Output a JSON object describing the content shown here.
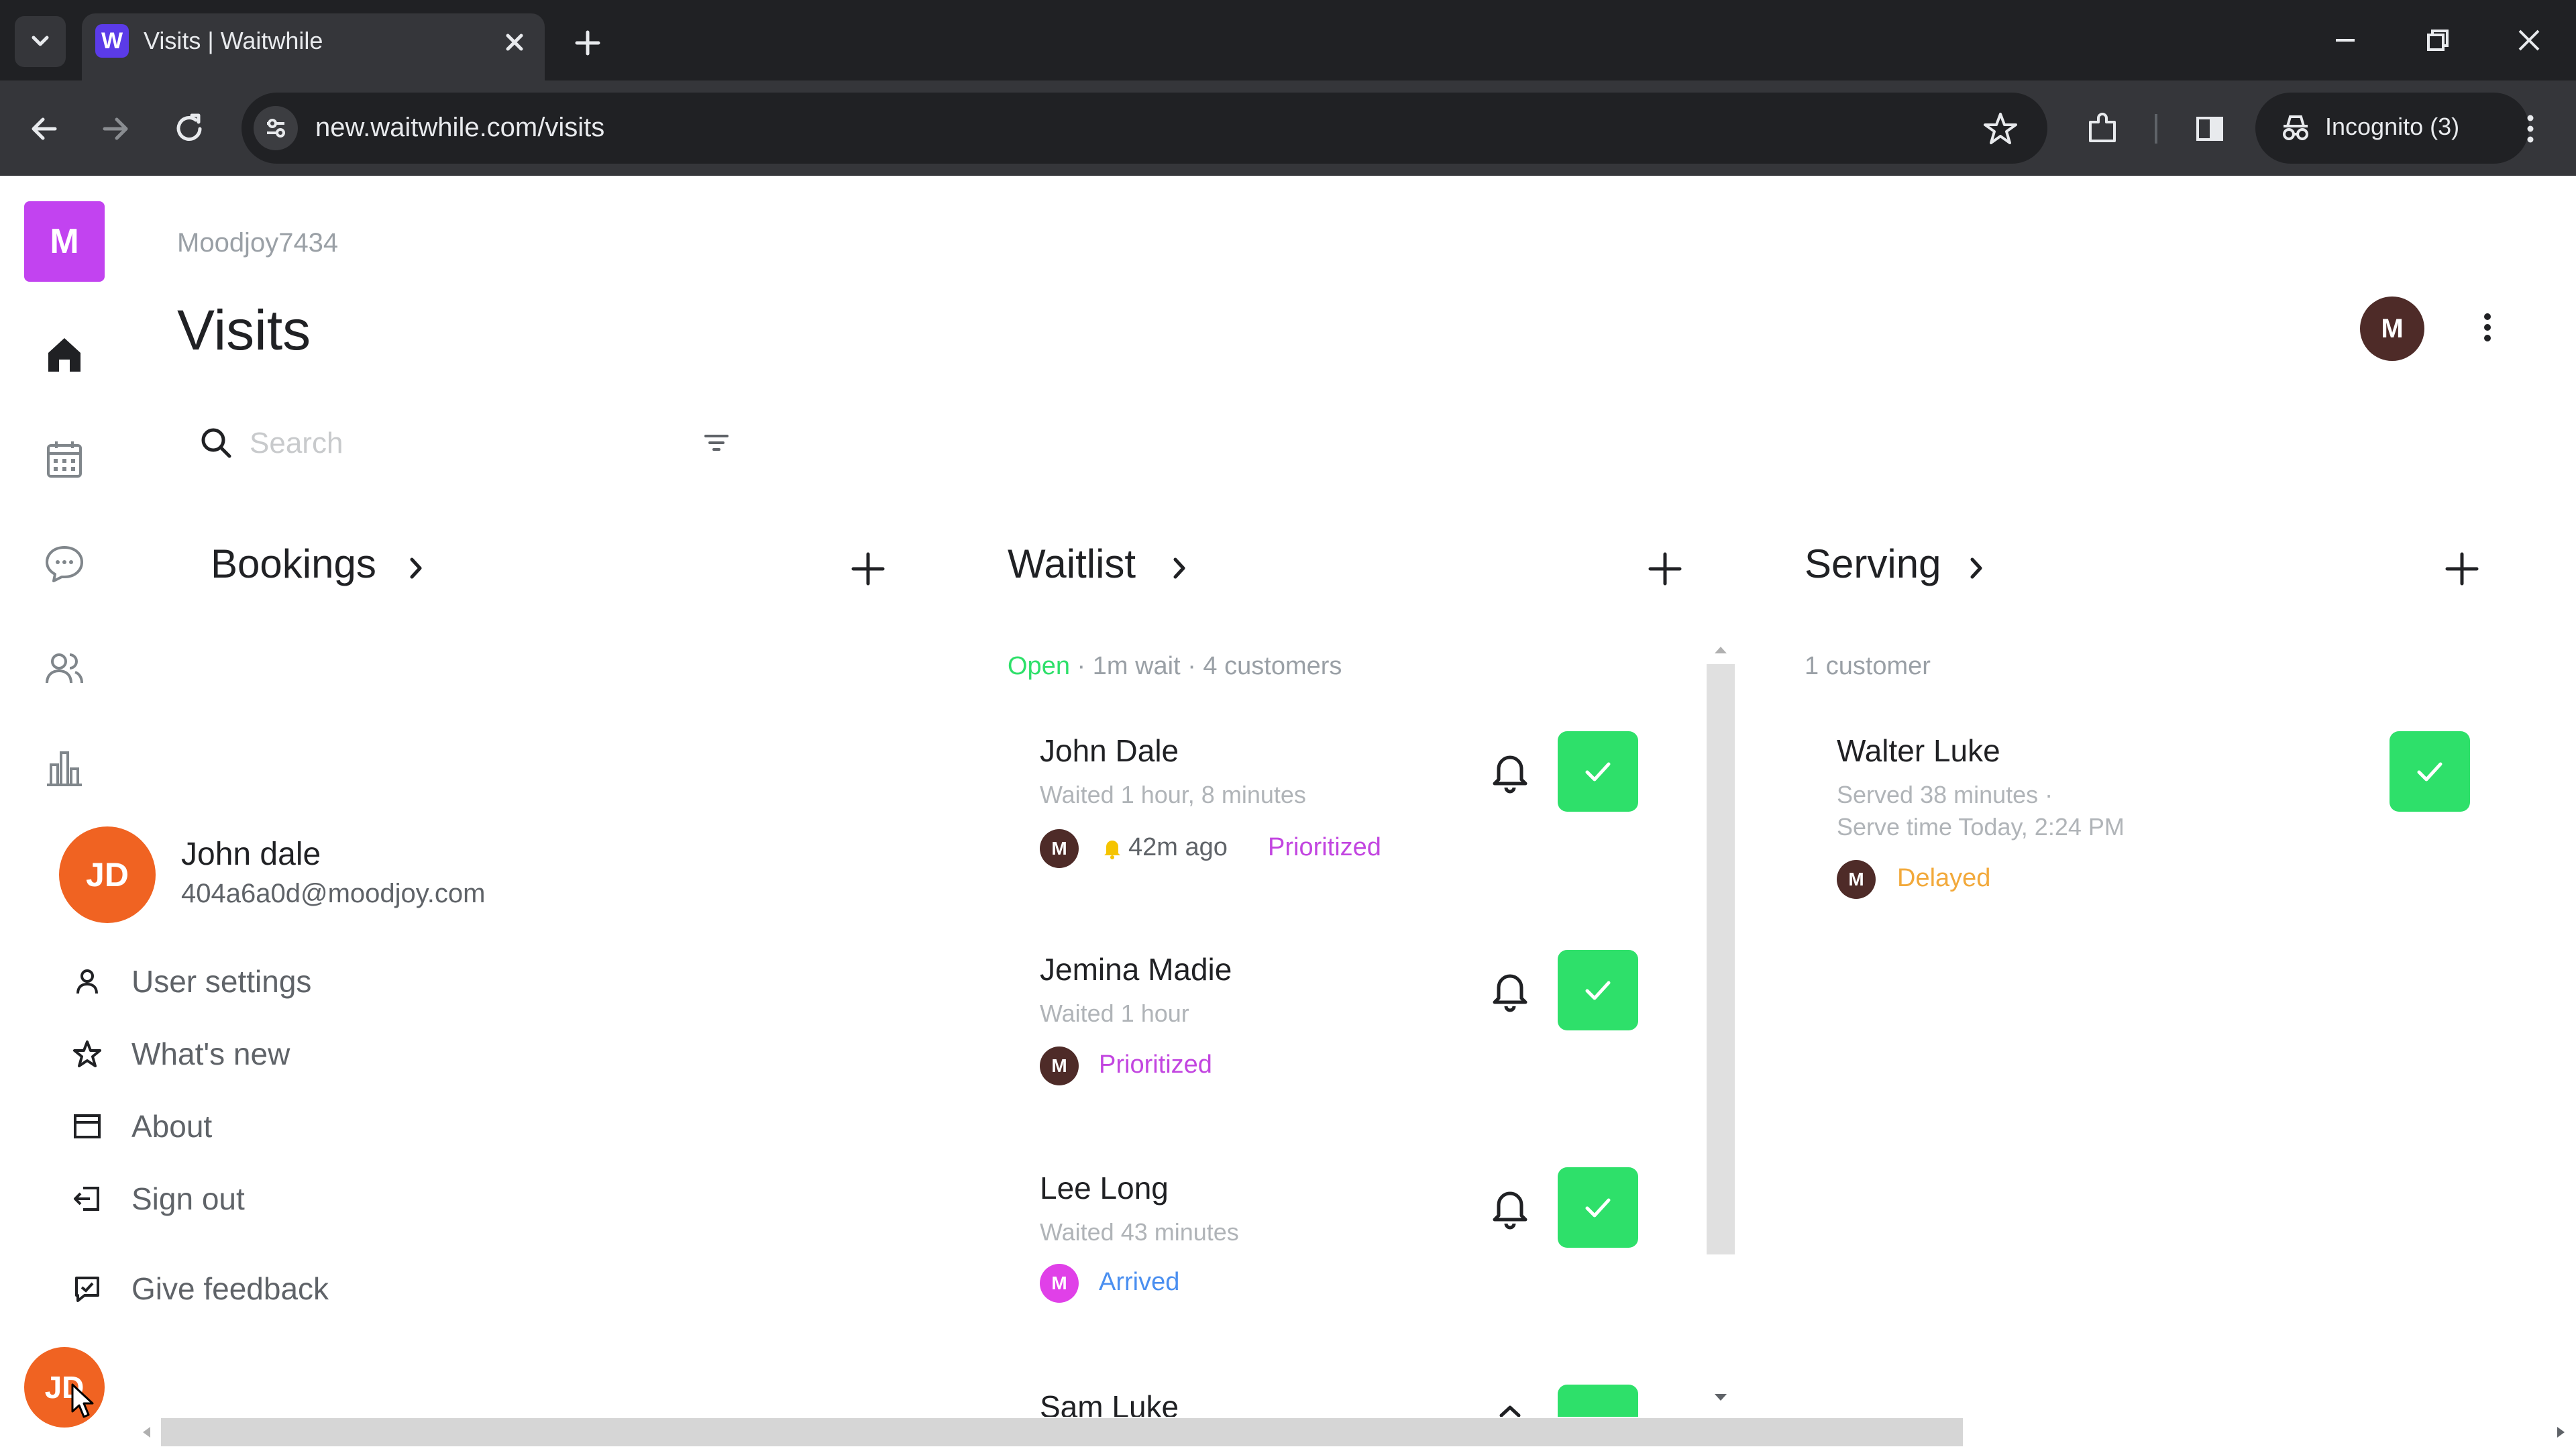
{
  "browser": {
    "tab_title": "Visits | Waitwhile",
    "tab_favicon": "W",
    "url": "new.waitwhile.com/visits",
    "incognito_label": "Incognito (3)"
  },
  "app": {
    "logo_letter": "M",
    "workspace": "Moodjoy7434",
    "page_title": "Visits",
    "user_avatar": "M",
    "search_placeholder": "Search"
  },
  "columns": {
    "bookings": {
      "title": "Bookings"
    },
    "waitlist": {
      "title": "Waitlist",
      "status_open": "Open",
      "status_rest": "· 1m wait · 4 customers",
      "items": [
        {
          "name": "John Dale",
          "sub": "Waited 1 hour, 8 minutes",
          "avatar": "M",
          "ago": "42m ago",
          "tag": "Prioritized"
        },
        {
          "name": "Jemina Madie",
          "sub": "Waited 1 hour",
          "avatar": "M",
          "tag": "Prioritized"
        },
        {
          "name": "Lee Long",
          "sub": "Waited 43 minutes",
          "avatar": "M",
          "tag": "Arrived"
        },
        {
          "name": "Sam Luke"
        }
      ]
    },
    "serving": {
      "title": "Serving",
      "count": "1 customer",
      "items": [
        {
          "name": "Walter Luke",
          "sub1": "Served 38 minutes ·",
          "sub2": "Serve time Today, 2:24 PM",
          "avatar": "M",
          "tag": "Delayed"
        }
      ]
    }
  },
  "profile_menu": {
    "initials": "JD",
    "name": "John dale",
    "email": "404a6a0d@moodjoy.com",
    "items": [
      "User settings",
      "What's new",
      "About",
      "Sign out",
      "Give feedback"
    ]
  },
  "colors": {
    "accent_green": "#2ee06a",
    "logo_purple": "#c243f0",
    "avatar_orange": "#f06322",
    "prioritized": "#c245e0",
    "arrived": "#4a8ff0",
    "delayed": "#f2a93b"
  }
}
